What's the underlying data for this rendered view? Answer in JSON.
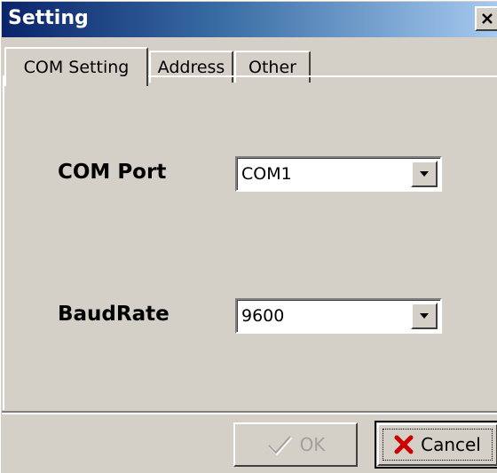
{
  "window": {
    "title": "Setting",
    "close_symbol": "✕"
  },
  "tabs": [
    {
      "label": "COM Setting",
      "active": true
    },
    {
      "label": "Address",
      "active": false
    },
    {
      "label": "Other",
      "active": false
    }
  ],
  "fields": {
    "com_port": {
      "label": "COM Port",
      "value": "COM1"
    },
    "baud_rate": {
      "label": "BaudRate",
      "value": "9600"
    }
  },
  "buttons": {
    "ok": {
      "label": "OK",
      "icon": "checkmark-icon",
      "enabled": false
    },
    "cancel": {
      "label": "Cancel",
      "icon": "red-x-icon",
      "enabled": true
    }
  },
  "colors": {
    "title_start": "#0a246a",
    "title_end": "#a6caf0",
    "face": "#d4d0c8",
    "cancel_icon": "#cc0000"
  }
}
